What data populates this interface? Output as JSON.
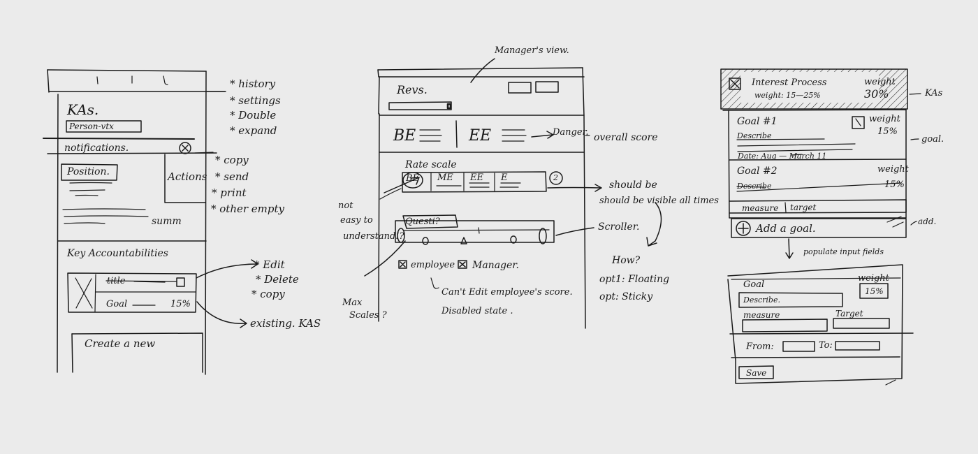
{
  "left": {
    "kas_title": "KAs.",
    "kas_tag": "Person-vtx",
    "notif_label": "notifications.",
    "notif_close": "×",
    "notif_options": [
      "* history",
      "* settings",
      "* Double",
      "* expand"
    ],
    "position_label": "Position.",
    "actions_label": "Actions",
    "actions_options": [
      "* copy",
      "* send",
      "* print",
      "* other empty"
    ],
    "summary_label": "summ",
    "key_section_title": "Key Accountabilities",
    "card_title_label": "title",
    "card_goal_label": "Goal",
    "card_weight": "15%",
    "card_options": [
      "* Edit",
      "* Delete",
      "* copy"
    ],
    "existing_kas_note": "existing. KAS",
    "create_new_label": "Create a new"
  },
  "middle": {
    "manager_view_note": "Manager's view.",
    "reviews_label": "Revs.",
    "score_left": "BE",
    "score_right": "EE",
    "score_arrow_label": "Danger.",
    "overall_score_note": "overall score",
    "rate_scale_label": "Rate scale",
    "scale_options": [
      "BE",
      "ME",
      "EE",
      "E"
    ],
    "scale_count": "2",
    "scale_note": "should be visible all times",
    "not_easy_note": [
      "not",
      "easy to",
      "understand!?"
    ],
    "question_label": "Questi?",
    "slider_note": "Scroller.",
    "max_scales_note": [
      "Max",
      "Scales ?"
    ],
    "employee_label": "employee",
    "manager_label": "Manager.",
    "cant_edit_note": "Can't Edit employee's score.",
    "disabled_note": "Disabled state .",
    "how_note": "How?",
    "opt1_note": "opt1: Floating",
    "opt2_note": "opt: Sticky"
  },
  "right": {
    "process_title": "Interest Process",
    "process_weight_label": "weight: 15—25%",
    "weight_label": "weight",
    "process_weight": "30%",
    "kas_note": "KAs",
    "goal1_title": "Goal #1",
    "goal1_weight_label": "weight",
    "goal1_weight": "15%",
    "goal1_desc": "Describe",
    "goal_note": "goal.",
    "date_label": "Date: Aug — March 11",
    "goal2_title": "Goal #2",
    "goal2_weight_label": "weight",
    "goal2_weight": "15%",
    "goal2_desc": "Describe",
    "measure_label": "measure",
    "target_label": "target",
    "add_goal_label": "Add a goal.",
    "add_note": "add.",
    "populate_note": "populate input fields",
    "form_goal_label": "Goal",
    "form_weight_label": "weight",
    "form_weight_value": "15%",
    "form_goal_value": "Describe.",
    "form_measure_label": "measure",
    "form_target_label": "Target",
    "from_label": "From:",
    "to_label": "To:",
    "save_label": "Save"
  }
}
